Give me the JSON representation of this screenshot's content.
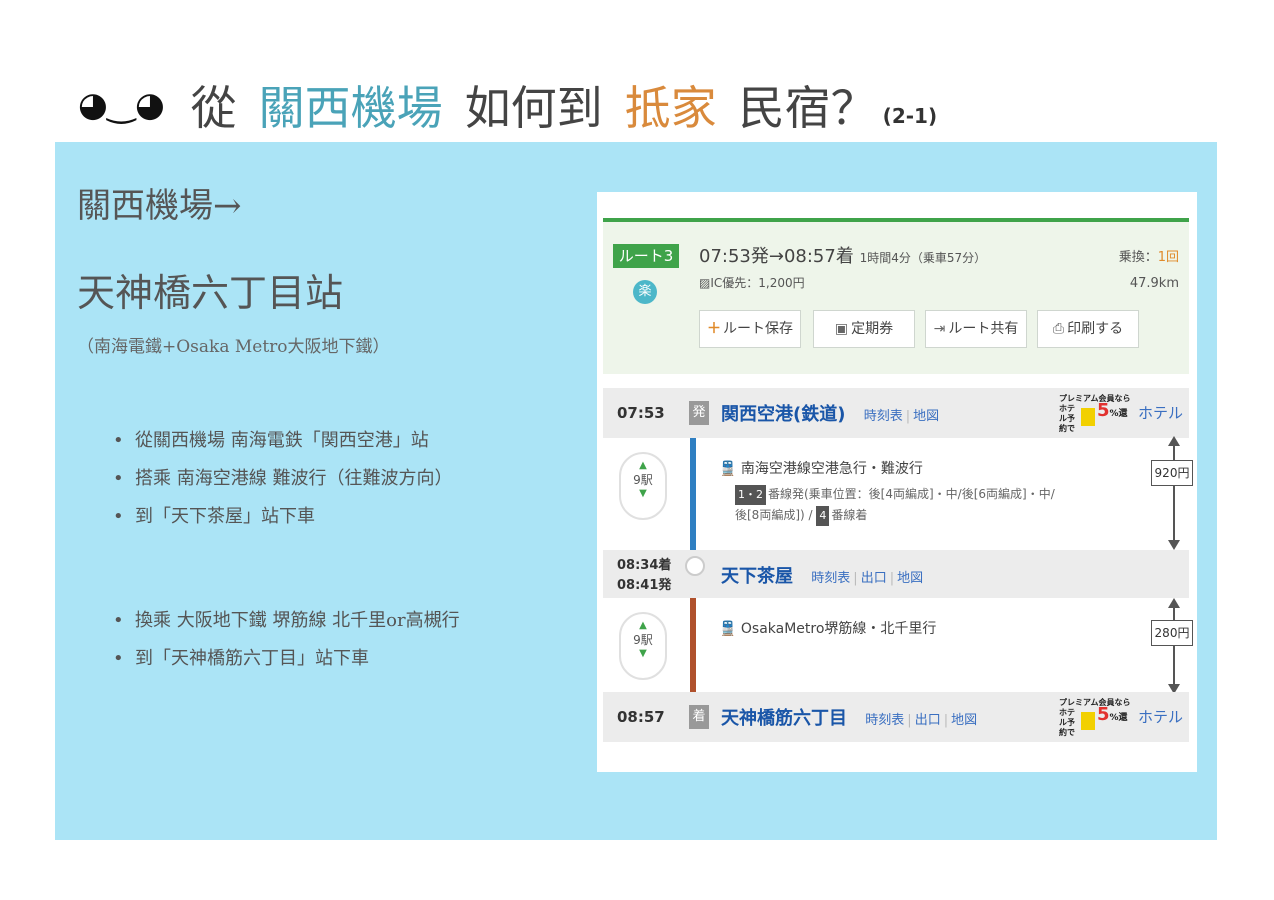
{
  "title": {
    "emoticon": "◕‿◕",
    "part1": "從",
    "part2": "關西機場",
    "part3": "如何到",
    "part4": "抵家",
    "part5": "民宿？",
    "number": "(2-1)"
  },
  "left": {
    "heading1": "關西機場→",
    "heading2": "天神橋六丁目站",
    "subtitle": "（南海電鐵+Osaka Metro大阪地下鐵）",
    "bullets_a": [
      "從關西機場 南海電鉄「関西空港」站",
      "搭乘 南海空港線 難波行（往難波方向）",
      "到「天下茶屋」站下車"
    ],
    "bullets_b": [
      "換乘 大阪地下鐵 堺筋線 北千里or高槻行",
      "到「天神橋筋六丁目」站下車"
    ]
  },
  "route": {
    "badge": "ルート3",
    "raku": "楽",
    "time": "07:53発→08:57着",
    "duration": "1時間4分（乗車57分）",
    "ic": "▨IC優先：1,200円",
    "transfer_label": "乗換：",
    "transfer_count": "1回",
    "distance": "47.9km",
    "buttons": {
      "save": "ルート保存",
      "commuter": "定期券",
      "share": "ルート共有",
      "print": "印刷する"
    }
  },
  "timeline": {
    "departure": {
      "time": "07:53",
      "tag": "発",
      "station": "関西空港(鉄道)",
      "timetable": "時刻表",
      "map": "地図",
      "promo_line1": "プレミアム会員なら",
      "promo_line2": "ホテル予約で",
      "promo_pct": "5",
      "promo_unit": "%還",
      "hotel": "ホテル"
    },
    "segment1": {
      "stops": "9駅",
      "train": "南海空港線空港急行・難波行",
      "plat_badge": "1・2",
      "platform_line1": "番線発(乗車位置：後[4両編成]・中/後[6両編成]・中/",
      "platform_line2_a": "後[8両編成]) /",
      "plat_badge2": "4",
      "platform_line2_b": "番線着",
      "fare": "920円"
    },
    "transfer": {
      "arrive": "08:34着",
      "depart": "08:41発",
      "station": "天下茶屋",
      "timetable": "時刻表",
      "exit": "出口",
      "map": "地図"
    },
    "segment2": {
      "stops": "9駅",
      "train": "OsakaMetro堺筋線・北千里行",
      "fare": "280円"
    },
    "arrival": {
      "time": "08:57",
      "tag": "着",
      "station": "天神橋筋六丁目",
      "timetable": "時刻表",
      "exit": "出口",
      "map": "地図",
      "promo_line1": "プレミアム会員なら",
      "promo_line2": "ホテル予約で",
      "promo_pct": "5",
      "promo_unit": "%還",
      "hotel": "ホテル"
    }
  },
  "colors": {
    "panel": "#abe4f6",
    "accent_blue": "#4aa3b8",
    "accent_orange": "#d98a3c",
    "route_green": "#3fa34a",
    "line_nankai": "#2f7fc2",
    "line_sakaisuji": "#b0512c"
  }
}
